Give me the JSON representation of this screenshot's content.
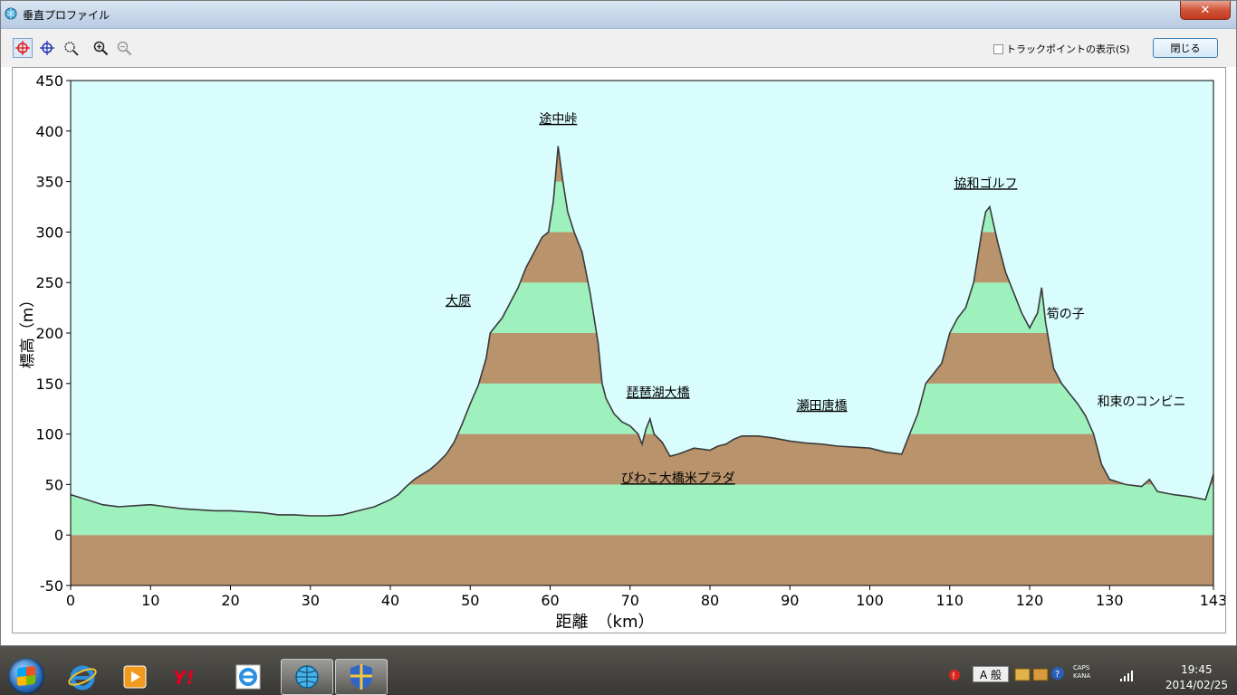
{
  "window": {
    "title": "垂直プロファイル",
    "track_points_label": "トラックポイントの表示(S)",
    "track_points_checked": false,
    "close_label": "閉じる"
  },
  "toolbar": {
    "tools": [
      "crosshair-red-icon",
      "crosshair-blue-icon",
      "zoom-area-icon",
      "zoom-in-icon",
      "zoom-out-icon"
    ]
  },
  "chart_data": {
    "type": "area",
    "xlabel": "距離　（km）",
    "ylabel": "標高（m）",
    "xlim": [
      0,
      143
    ],
    "ylim": [
      -50,
      450
    ],
    "x_ticks": [
      0,
      10,
      20,
      30,
      40,
      50,
      60,
      70,
      80,
      90,
      100,
      110,
      120,
      130,
      143
    ],
    "y_ticks": [
      -50,
      0,
      50,
      100,
      150,
      200,
      250,
      300,
      350,
      400,
      450
    ],
    "band_colors": [
      "#b9936c",
      "#9ef0bd"
    ],
    "background": "#d9fdfd",
    "profile": [
      [
        0,
        40
      ],
      [
        2,
        35
      ],
      [
        4,
        30
      ],
      [
        6,
        28
      ],
      [
        8,
        29
      ],
      [
        10,
        30
      ],
      [
        12,
        28
      ],
      [
        14,
        26
      ],
      [
        16,
        25
      ],
      [
        18,
        24
      ],
      [
        20,
        24
      ],
      [
        22,
        23
      ],
      [
        24,
        22
      ],
      [
        26,
        20
      ],
      [
        28,
        20
      ],
      [
        30,
        19
      ],
      [
        32,
        19
      ],
      [
        34,
        20
      ],
      [
        36,
        24
      ],
      [
        38,
        28
      ],
      [
        40,
        35
      ],
      [
        41,
        40
      ],
      [
        42,
        48
      ],
      [
        43,
        55
      ],
      [
        44,
        60
      ],
      [
        45,
        65
      ],
      [
        46,
        72
      ],
      [
        47,
        80
      ],
      [
        48,
        92
      ],
      [
        49,
        110
      ],
      [
        50,
        130
      ],
      [
        51,
        148
      ],
      [
        52,
        175
      ],
      [
        52.5,
        200
      ],
      [
        53,
        205
      ],
      [
        54,
        215
      ],
      [
        55,
        230
      ],
      [
        56,
        245
      ],
      [
        57,
        265
      ],
      [
        58,
        280
      ],
      [
        59,
        295
      ],
      [
        59.8,
        300
      ],
      [
        60.4,
        330
      ],
      [
        61,
        385
      ],
      [
        61.6,
        350
      ],
      [
        62.2,
        320
      ],
      [
        63,
        300
      ],
      [
        64,
        280
      ],
      [
        65,
        240
      ],
      [
        66,
        190
      ],
      [
        66.5,
        150
      ],
      [
        67,
        135
      ],
      [
        68,
        120
      ],
      [
        69,
        112
      ],
      [
        70,
        108
      ],
      [
        71,
        100
      ],
      [
        71.5,
        90
      ],
      [
        72,
        105
      ],
      [
        72.5,
        115
      ],
      [
        73,
        100
      ],
      [
        74,
        92
      ],
      [
        75,
        78
      ],
      [
        76,
        80
      ],
      [
        77,
        83
      ],
      [
        78,
        86
      ],
      [
        79,
        85
      ],
      [
        80,
        84
      ],
      [
        81,
        88
      ],
      [
        82,
        90
      ],
      [
        83,
        95
      ],
      [
        84,
        98
      ],
      [
        86,
        98
      ],
      [
        88,
        96
      ],
      [
        90,
        93
      ],
      [
        92,
        91
      ],
      [
        94,
        90
      ],
      [
        96,
        88
      ],
      [
        98,
        87
      ],
      [
        100,
        86
      ],
      [
        102,
        82
      ],
      [
        104,
        80
      ],
      [
        105,
        100
      ],
      [
        106,
        120
      ],
      [
        107,
        150
      ],
      [
        108,
        160
      ],
      [
        109,
        170
      ],
      [
        110,
        200
      ],
      [
        111,
        215
      ],
      [
        112,
        225
      ],
      [
        113,
        250
      ],
      [
        114,
        300
      ],
      [
        114.5,
        320
      ],
      [
        115,
        325
      ],
      [
        116,
        290
      ],
      [
        117,
        260
      ],
      [
        118,
        240
      ],
      [
        119,
        220
      ],
      [
        120,
        205
      ],
      [
        121,
        220
      ],
      [
        121.5,
        245
      ],
      [
        122,
        210
      ],
      [
        123,
        165
      ],
      [
        124,
        150
      ],
      [
        125,
        140
      ],
      [
        126,
        130
      ],
      [
        127,
        118
      ],
      [
        128,
        100
      ],
      [
        129,
        70
      ],
      [
        130,
        55
      ],
      [
        132,
        50
      ],
      [
        134,
        48
      ],
      [
        135,
        55
      ],
      [
        136,
        43
      ],
      [
        138,
        40
      ],
      [
        140,
        38
      ],
      [
        142,
        35
      ],
      [
        143,
        60
      ]
    ],
    "annotations": [
      {
        "text": "途中峠",
        "x": 61,
        "y": 408,
        "underline": true
      },
      {
        "text": "大原",
        "x": 48.5,
        "y": 228,
        "underline": true
      },
      {
        "text": "琵琶湖大橋",
        "x": 73.5,
        "y": 137,
        "underline": true
      },
      {
        "text": "びわこ大橋米プラダ",
        "x": 76,
        "y": 52,
        "underline": true
      },
      {
        "text": "瀬田唐橋",
        "x": 94,
        "y": 124,
        "underline": true
      },
      {
        "text": "協和ゴルフ",
        "x": 114.5,
        "y": 344,
        "underline": true
      },
      {
        "text": "筍の子",
        "x": 124.5,
        "y": 215,
        "underline": false
      },
      {
        "text": "和束のコンビニ",
        "x": 134,
        "y": 128,
        "underline": false
      }
    ]
  },
  "taskbar": {
    "apps": [
      "ie-icon",
      "media-icon",
      "yahoo-icon",
      "ie-icon-2",
      "globe-icon",
      "shield-icon"
    ],
    "ime_label": "A 般",
    "caps": "CAPS",
    "kana": "KANA",
    "time": "19:45",
    "date": "2014/02/25"
  }
}
